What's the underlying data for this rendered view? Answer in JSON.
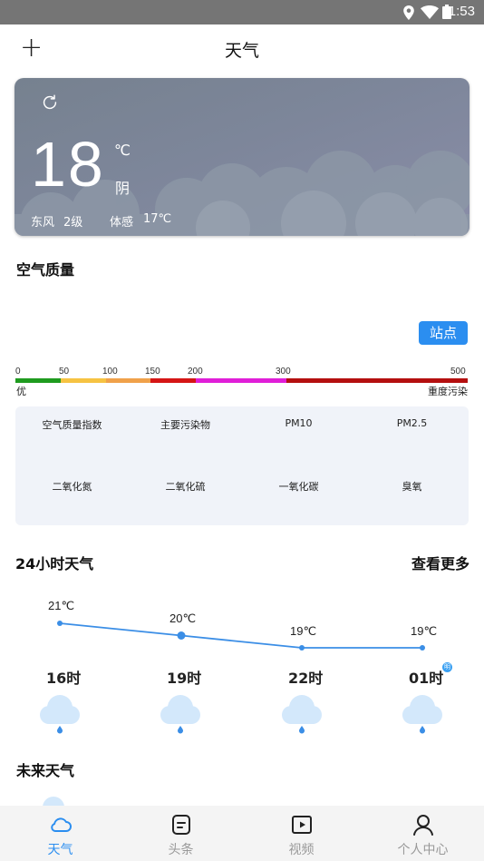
{
  "status_bar": {
    "time": "1:53"
  },
  "header": {
    "title": "天气",
    "add_label": "+"
  },
  "current": {
    "temperature": "18",
    "unit": "℃",
    "condition": "阴",
    "wind_dir": "东风",
    "wind_level": "2级",
    "feels_label": "体感",
    "feels_value": "17℃"
  },
  "air_quality": {
    "title": "空气质量",
    "station_button": "站点",
    "scale": {
      "ticks": [
        "0",
        "50",
        "100",
        "150",
        "200",
        "300",
        "500"
      ],
      "best_label": "优",
      "worst_label": "重度污染",
      "colors": [
        "#1f9b1f",
        "#f6c342",
        "#f0a14a",
        "#d51515",
        "#e01ed8",
        "#b40f0f"
      ]
    },
    "items": [
      "空气质量指数",
      "主要污染物",
      "PM10",
      "PM2.5",
      "二氧化氮",
      "二氧化硫",
      "一氧化碳",
      "臭氧"
    ]
  },
  "hourly": {
    "title": "24小时天气",
    "more_label": "查看更多",
    "badge": "明",
    "items": [
      {
        "hour": "16时",
        "temp": "21℃",
        "value": 21
      },
      {
        "hour": "19时",
        "temp": "20℃",
        "value": 20
      },
      {
        "hour": "22时",
        "temp": "19℃",
        "value": 19
      },
      {
        "hour": "01时",
        "temp": "19℃",
        "value": 19
      }
    ]
  },
  "future": {
    "title": "未来天气"
  },
  "nav": {
    "items": [
      {
        "label": "天气",
        "icon": "cloud-icon",
        "active": true
      },
      {
        "label": "头条",
        "icon": "news-icon",
        "active": false
      },
      {
        "label": "视频",
        "icon": "video-icon",
        "active": false
      },
      {
        "label": "个人中心",
        "icon": "profile-icon",
        "active": false
      }
    ],
    "active_color": "#2b8ef0"
  }
}
